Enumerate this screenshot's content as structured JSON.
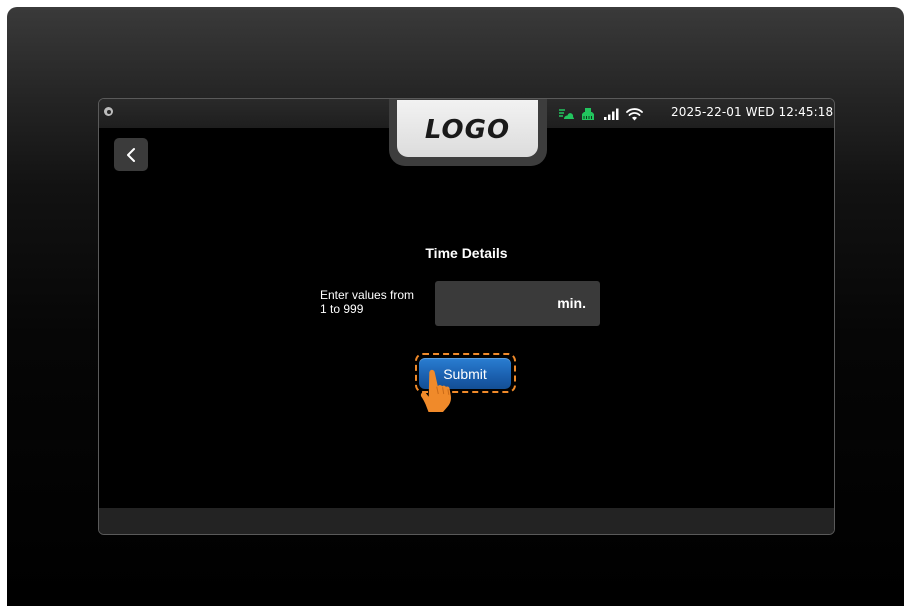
{
  "header": {
    "logo_text": "LOGO",
    "datetime": "2025-22-01 WED 12:45:18",
    "status_icons": [
      "cloud-sync-icon",
      "network-port-icon",
      "signal-bars-icon",
      "wifi-icon"
    ],
    "status_colors": {
      "green": "#22c55e",
      "white": "#ffffff"
    }
  },
  "nav": {
    "back_icon": "chevron-left-icon"
  },
  "main": {
    "title": "Time Details",
    "hint": "Enter values from 1 to 999",
    "input": {
      "value": "",
      "unit": "min."
    },
    "submit_label": "Submit"
  },
  "colors": {
    "accent": "#1f6fc4",
    "highlight": "#f08a2a",
    "background": "#000000",
    "field": "#3a3a3a"
  }
}
